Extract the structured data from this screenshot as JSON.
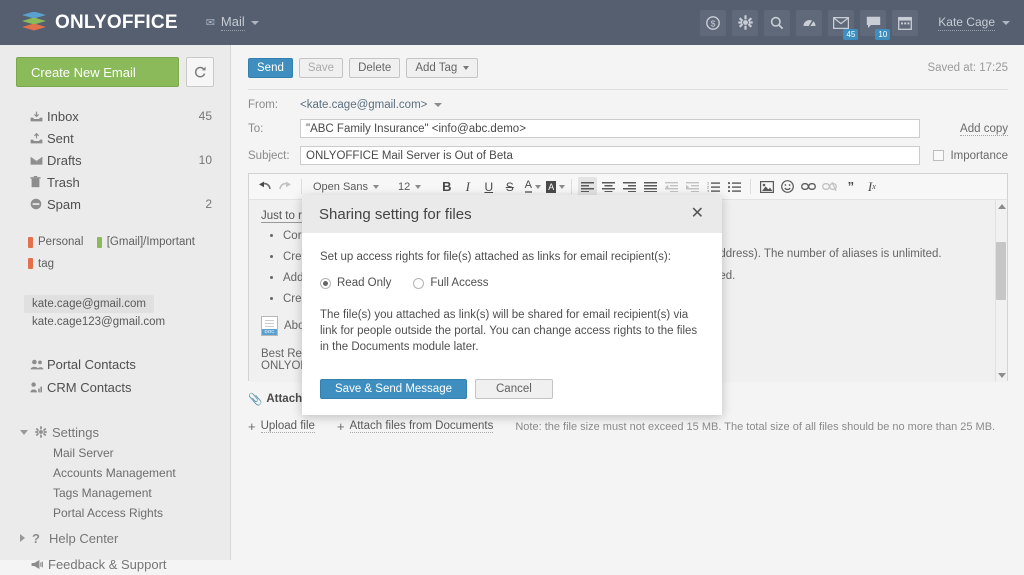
{
  "header": {
    "logo_text": "ONLYOFFICE",
    "module": {
      "icon": "mail-icon",
      "label": "Mail"
    },
    "icons": [
      {
        "name": "payments-icon",
        "glyph": "$"
      },
      {
        "name": "settings-gear-icon",
        "glyph": "gear"
      },
      {
        "name": "search-icon",
        "glyph": "search"
      },
      {
        "name": "gauge-icon",
        "glyph": "gauge"
      },
      {
        "name": "mail-icon",
        "glyph": "envelope",
        "badge": "45"
      },
      {
        "name": "chat-icon",
        "glyph": "chat",
        "badge": "10"
      },
      {
        "name": "calendar-icon",
        "glyph": "calendar"
      }
    ],
    "user_name": "Kate Cage"
  },
  "sidebar": {
    "create_label": "Create New Email",
    "refresh_icon": "refresh-icon",
    "folders": [
      {
        "label": "Inbox",
        "count": "45",
        "icon": "inbox-icon"
      },
      {
        "label": "Sent",
        "count": "",
        "icon": "sent-icon"
      },
      {
        "label": "Drafts",
        "count": "10",
        "icon": "drafts-icon"
      },
      {
        "label": "Trash",
        "count": "",
        "icon": "trash-icon"
      },
      {
        "label": "Spam",
        "count": "2",
        "icon": "spam-icon"
      }
    ],
    "tags": [
      {
        "label": "Personal",
        "color": "#e2714b"
      },
      {
        "label": "[Gmail]/Important",
        "color": "#8bba5a"
      },
      {
        "label": "tag",
        "color": "#e2714b"
      }
    ],
    "accounts": [
      {
        "label": "kate.cage@gmail.com",
        "active": true
      },
      {
        "label": "kate.cage123@gmail.com",
        "active": false
      }
    ],
    "contacts": [
      {
        "label": "Portal Contacts",
        "icon": "users-icon"
      },
      {
        "label": "CRM Contacts",
        "icon": "crm-icon"
      }
    ],
    "settings": {
      "label": "Settings",
      "icon": "gear-icon",
      "items": [
        "Mail Server",
        "Accounts Management",
        "Tags Management",
        "Portal Access Rights"
      ]
    },
    "help_center": {
      "label": "Help Center",
      "icon": "question-icon"
    },
    "feedback": {
      "label": "Feedback & Support",
      "icon": "megaphone-icon"
    }
  },
  "main": {
    "actions": {
      "send": "Send",
      "save": "Save",
      "delete": "Delete",
      "add_tag": "Add Tag"
    },
    "saved_at": "Saved at: 17:25",
    "fields": {
      "from_label": "From:",
      "from_value": "<kate.cage@gmail.com>",
      "to_label": "To:",
      "to_value": "\"ABC Family Insurance\" <info@abc.demo>",
      "subject_label": "Subject:",
      "subject_value": "ONLYOFFICE Mail Server is Out of Beta",
      "add_copy": "Add copy",
      "importance": "Importance"
    },
    "format_bar": {
      "font_family": "Open Sans",
      "font_size": "12",
      "buttons": [
        "undo-icon",
        "redo-icon",
        "bold-icon",
        "italic-icon",
        "underline-icon",
        "strikethrough-icon",
        "text-color-icon",
        "highlight-color-icon",
        "align-left-icon",
        "align-center-icon",
        "align-right-icon",
        "align-justify-icon",
        "outdent-icon",
        "indent-icon",
        "ordered-list-icon",
        "unordered-list-icon",
        "image-icon",
        "emoji-icon",
        "link-icon",
        "unlink-icon",
        "blockquote-icon",
        "clear-format-icon"
      ]
    },
    "message": {
      "lead": "Just to re",
      "bullets": [
        "Cor",
        "Cre",
        "Add",
        "Cre"
      ],
      "doc_label": "Abou",
      "signature_line1": "Best Rega",
      "signature_line2": "ONLYOFF",
      "visible_right_line1": "address). The number of aliases is unlimited.",
      "visible_right_line2": "ded."
    },
    "attachments": {
      "title": "Attachments:",
      "upload_file": "Upload file",
      "attach_from_documents": "Attach files from Documents",
      "note": "Note: the file size must not exceed 15 MB. The total size of all files should be no more than 25 MB."
    }
  },
  "modal": {
    "title": "Sharing setting for files",
    "close_icon": "close-icon",
    "intro": "Set up access rights for file(s) attached as links for email recipient(s):",
    "options": [
      {
        "label": "Read Only",
        "checked": true
      },
      {
        "label": "Full Access",
        "checked": false
      }
    ],
    "description": "The file(s) you attached as link(s) will be shared for email recipient(s) via link for people outside the portal. You can change access rights to the files in the Documents module later.",
    "primary_button": "Save & Send Message",
    "secondary_button": "Cancel"
  },
  "colors": {
    "header_bg": "#555f70",
    "accent_blue": "#3e8fbf",
    "accent_green": "#8bba5a",
    "tag_orange": "#e2714b"
  }
}
